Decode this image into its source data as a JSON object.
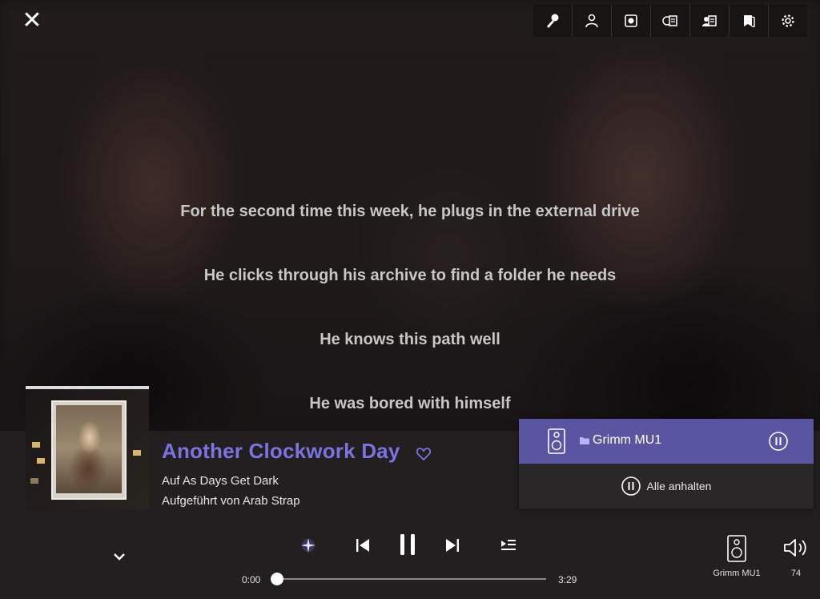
{
  "lyrics": [
    "For the second time this week, he plugs in the external drive",
    "He clicks through his archive to find a folder he needs",
    "He knows this path well",
    "He was bored with himself"
  ],
  "toolbar": {
    "icons": [
      "microphone-icon",
      "user-icon",
      "record-icon",
      "playlist-view-icon",
      "credits-icon",
      "booklet-icon",
      "gear-icon"
    ]
  },
  "track": {
    "title": "Another Clockwork Day",
    "album": "Auf As Days Get Dark",
    "artist": "Aufgeführt von Arab Strap"
  },
  "zones": {
    "active_zone_name": "Grimm MU1",
    "pause_all_label": "Alle anhalten"
  },
  "playback": {
    "current_time": "0:00",
    "total_time": "3:29",
    "progress": 0.0
  },
  "output": {
    "device_label": "Grimm MU1",
    "volume": "74"
  },
  "colors": {
    "accent": "#7b74e0",
    "zone_highlight": "#5a55a0"
  }
}
